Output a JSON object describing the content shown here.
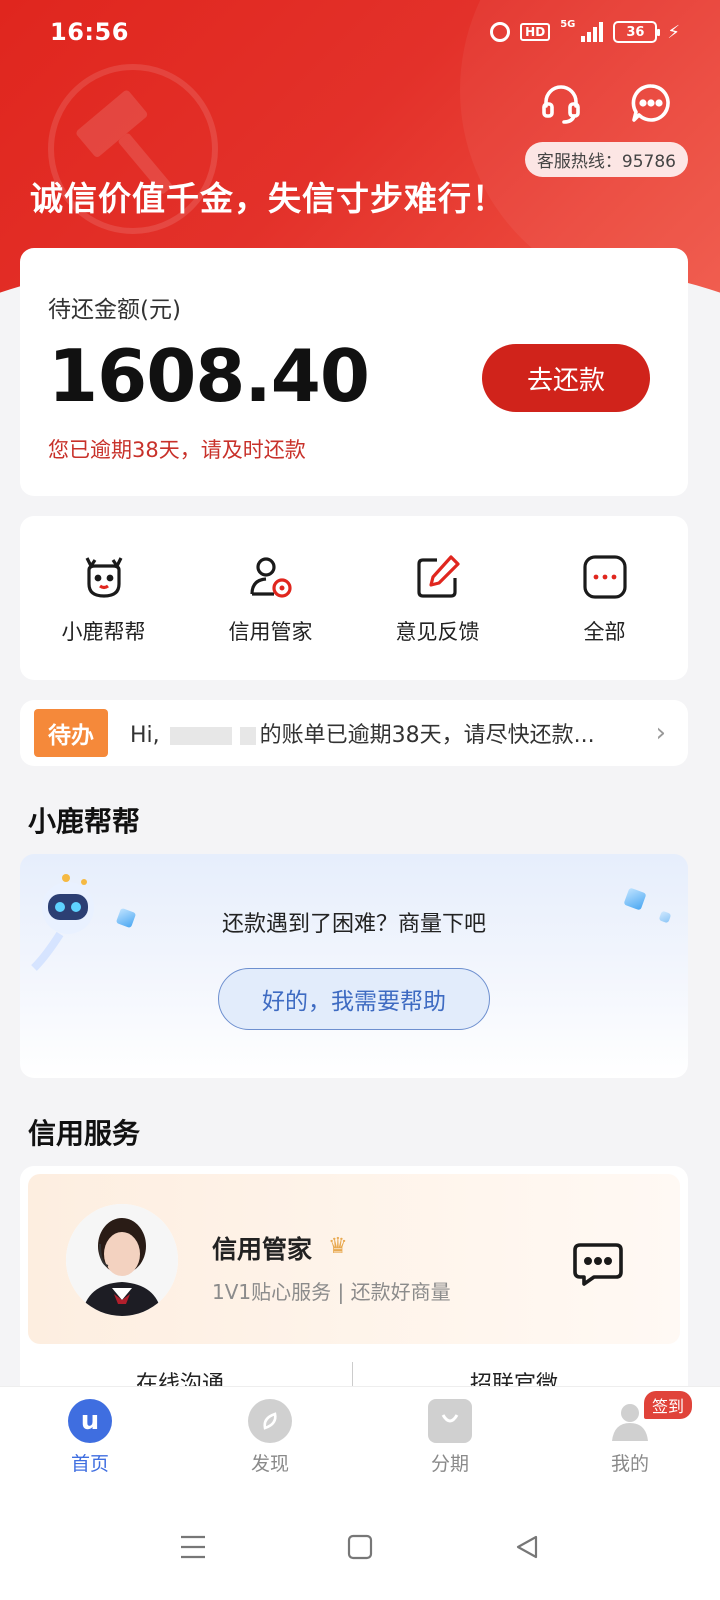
{
  "status_bar": {
    "time": "16:56",
    "hd": "HD",
    "network": "5G",
    "battery": "36"
  },
  "header": {
    "hotline": "客服热线：95786",
    "slogan": "诚信价值千金，失信寸步难行！",
    "icons": [
      "headset-icon",
      "chat-icon"
    ]
  },
  "balance": {
    "label": "待还金额(元)",
    "amount": "1608.40",
    "warning": "您已逾期38天，请及时还款",
    "repay_button": "去还款"
  },
  "quick_actions": [
    {
      "label": "小鹿帮帮",
      "icon": "deer-icon"
    },
    {
      "label": "信用管家",
      "icon": "credit-steward-icon"
    },
    {
      "label": "意见反馈",
      "icon": "feedback-edit-icon"
    },
    {
      "label": "全部",
      "icon": "more-icon"
    }
  ],
  "todo": {
    "badge": "待办",
    "greeting": "Hi,",
    "message": "的账单已逾期38天，请尽快还款..."
  },
  "help_section": {
    "title": "小鹿帮帮",
    "question": "还款遇到了困难？商量下吧",
    "button": "好的，我需要帮助"
  },
  "service_section": {
    "title": "信用服务",
    "name": "信用管家",
    "description": "1V1贴心服务 | 还款好商量",
    "link_left": "在线沟通",
    "link_right": "招联官微"
  },
  "tabbar": [
    {
      "label": "首页",
      "icon": "home-u-icon",
      "active": true
    },
    {
      "label": "发现",
      "icon": "discover-compass-icon",
      "active": false
    },
    {
      "label": "分期",
      "icon": "installment-bag-icon",
      "active": false
    },
    {
      "label": "我的",
      "icon": "profile-icon",
      "active": false,
      "badge": "签到"
    }
  ],
  "colors": {
    "brand_red": "#d0231b",
    "accent_blue": "#3f6ee0",
    "todo_orange": "#f5893a"
  }
}
